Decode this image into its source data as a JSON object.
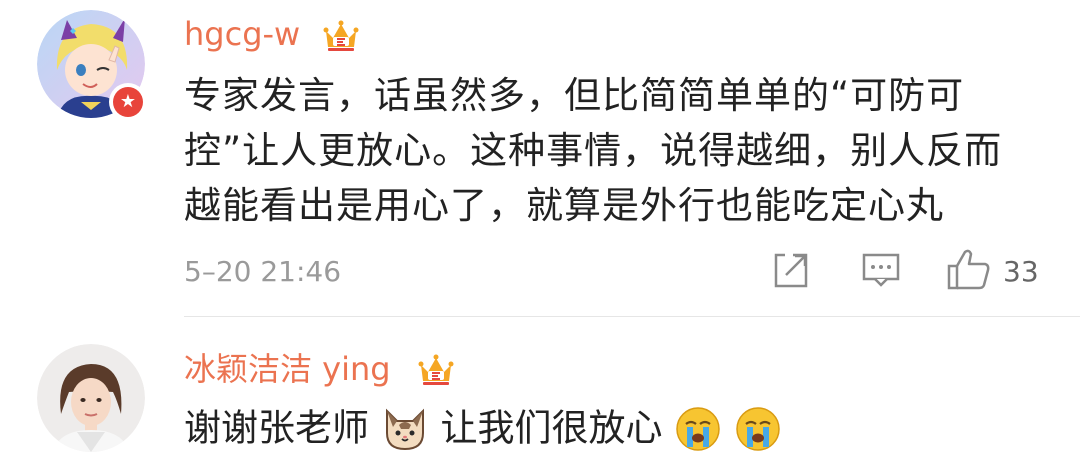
{
  "comments": [
    {
      "username": "hgcg-w",
      "avatar_icon": "anime-avatar",
      "verified_badge_icon": "verified-star-icon",
      "member_badge_icon": "crown-vip-icon",
      "content_lines": [
        "专家发言，话虽然多，但比简简单单的“可防可",
        "控”让人更放心。这种事情，说得越细，别人反而",
        "越能看出是用心了，就算是外行也能吃定心丸"
      ],
      "time": "5–20 21:46",
      "actions": {
        "share_icon": "share-icon",
        "comment_icon": "comment-icon",
        "like_icon": "thumbs-up-icon",
        "like_count": "33"
      }
    },
    {
      "username": "冰颖洁洁 ying",
      "avatar_icon": "user-photo-avatar",
      "member_badge_icon": "crown-vip-icon",
      "content_part1": "谢谢张老师",
      "content_part2": "让我们很放心",
      "emojis": [
        "cat-face-emoji",
        "crying-face-emoji",
        "crying-face-emoji"
      ]
    }
  ],
  "colors": {
    "username": "#eb7350",
    "text": "#222222",
    "meta": "#9a9a9a",
    "crown": "#f5a623"
  }
}
